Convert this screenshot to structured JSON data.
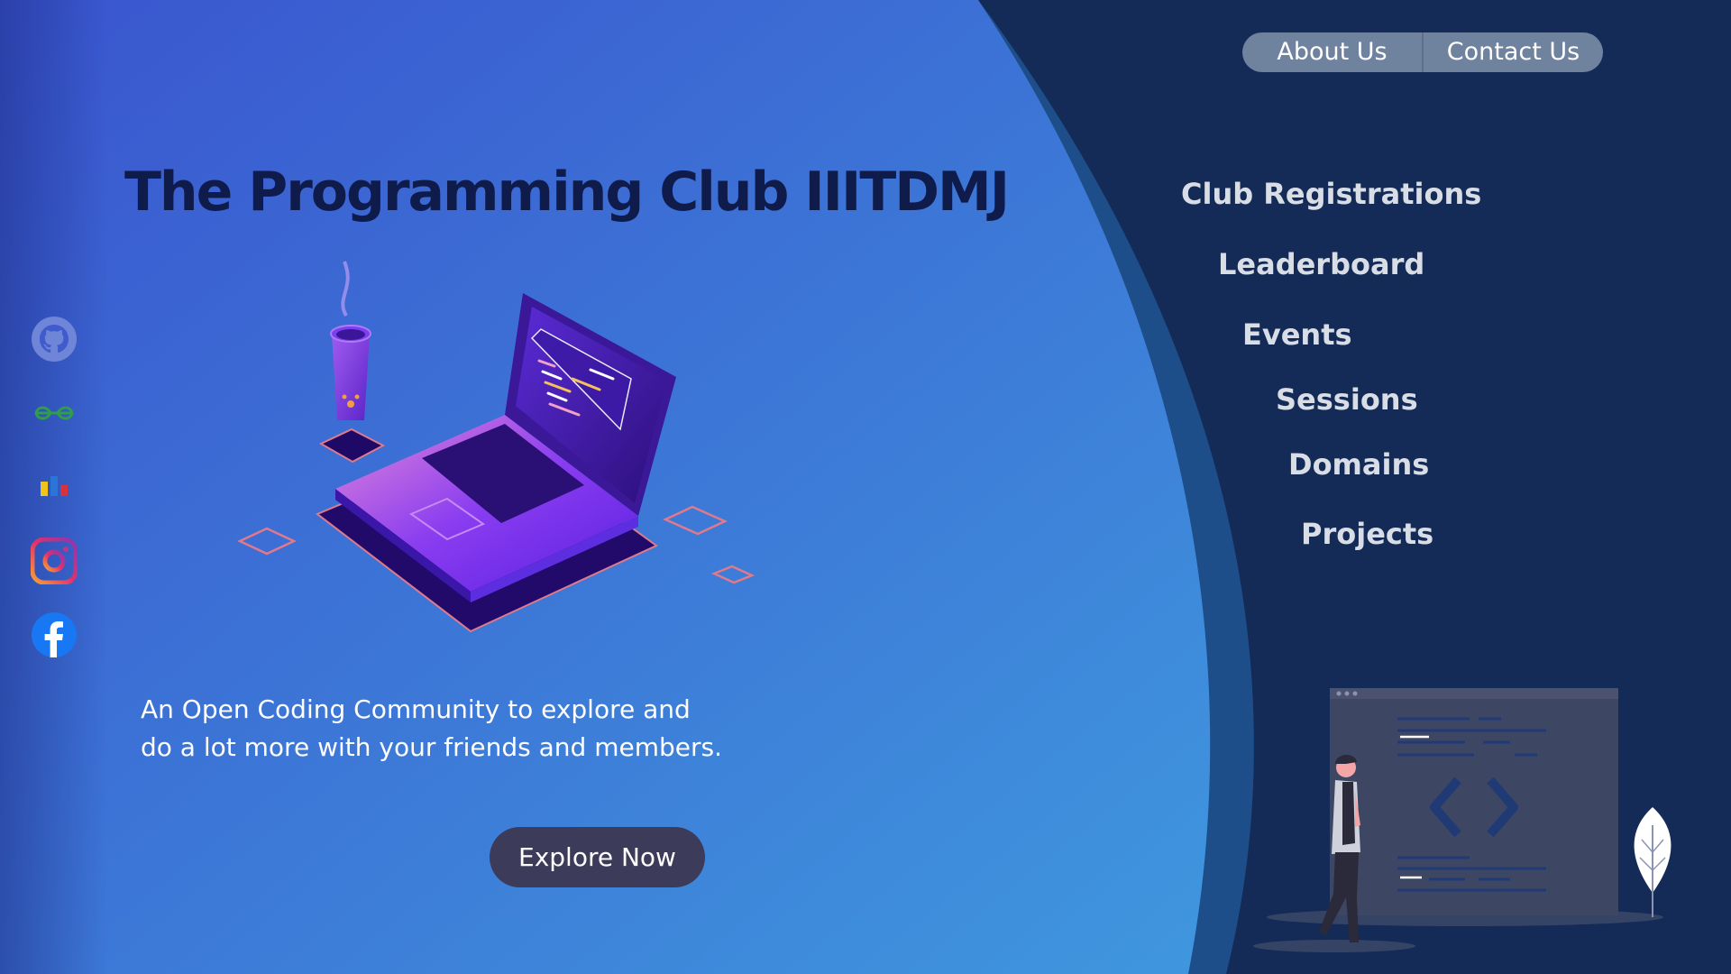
{
  "nav": {
    "about_label": "About Us",
    "contact_label": "Contact Us"
  },
  "hero": {
    "title": "The Programming Club IIITDMJ",
    "description_line1": "An Open Coding Community to explore and",
    "description_line2": "do a lot more with your friends and members.",
    "cta_label": "Explore Now"
  },
  "menu": {
    "items": [
      {
        "label": "Club Registrations"
      },
      {
        "label": "Leaderboard"
      },
      {
        "label": "Events"
      },
      {
        "label": "Sessions"
      },
      {
        "label": "Domains"
      },
      {
        "label": "Projects"
      }
    ]
  },
  "social": [
    {
      "icon": "github-icon"
    },
    {
      "icon": "geeksforgeeks-icon"
    },
    {
      "icon": "codechef-bars-icon"
    },
    {
      "icon": "instagram-icon"
    },
    {
      "icon": "facebook-icon"
    }
  ],
  "colors": {
    "title": "#0f1c4b",
    "right_panel": "#142b57",
    "hero_gradient_start": "#3a55cf",
    "hero_gradient_end": "#3f97de",
    "cta_button": "#3d3b5a",
    "nav_pill": "#6f829e"
  }
}
